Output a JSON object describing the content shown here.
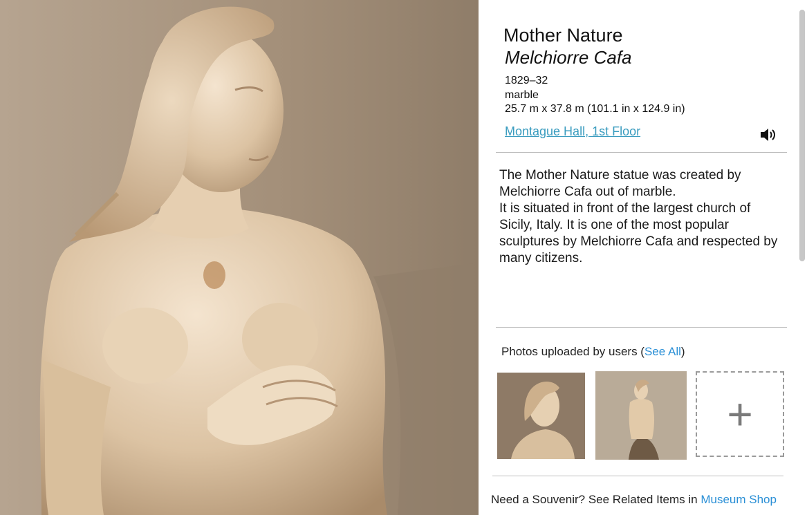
{
  "artwork": {
    "title": "Mother Nature",
    "artist": "Melchiorre Cafa",
    "date": "1829–32",
    "medium": "marble",
    "dimensions": "25.7 m x 37.8 m (101.1 in x 124.9 in)",
    "location_link": "Montague Hall, 1st Floor",
    "audio_icon": "speaker-icon"
  },
  "description": {
    "paragraph_1": "The Mother Nature statue was created by Melchiorre Cafa out of marble.",
    "paragraph_2": "It is situated in front of the largest church of Sicily, Italy. It is one of the most popular sculptures by Melchiorre Cafa and respected by many citizens."
  },
  "user_photos": {
    "heading": "Photos uploaded by users (",
    "see_all": "See All",
    "heading_close": ")",
    "add_icon": "+"
  },
  "souvenir": {
    "text": "Need a Souvenir? See Related Items in ",
    "link": "Museum Shop"
  },
  "colors": {
    "link": "#3a9cbf",
    "accent_link": "#2a8fd6",
    "sepia_background": "#a99985"
  }
}
